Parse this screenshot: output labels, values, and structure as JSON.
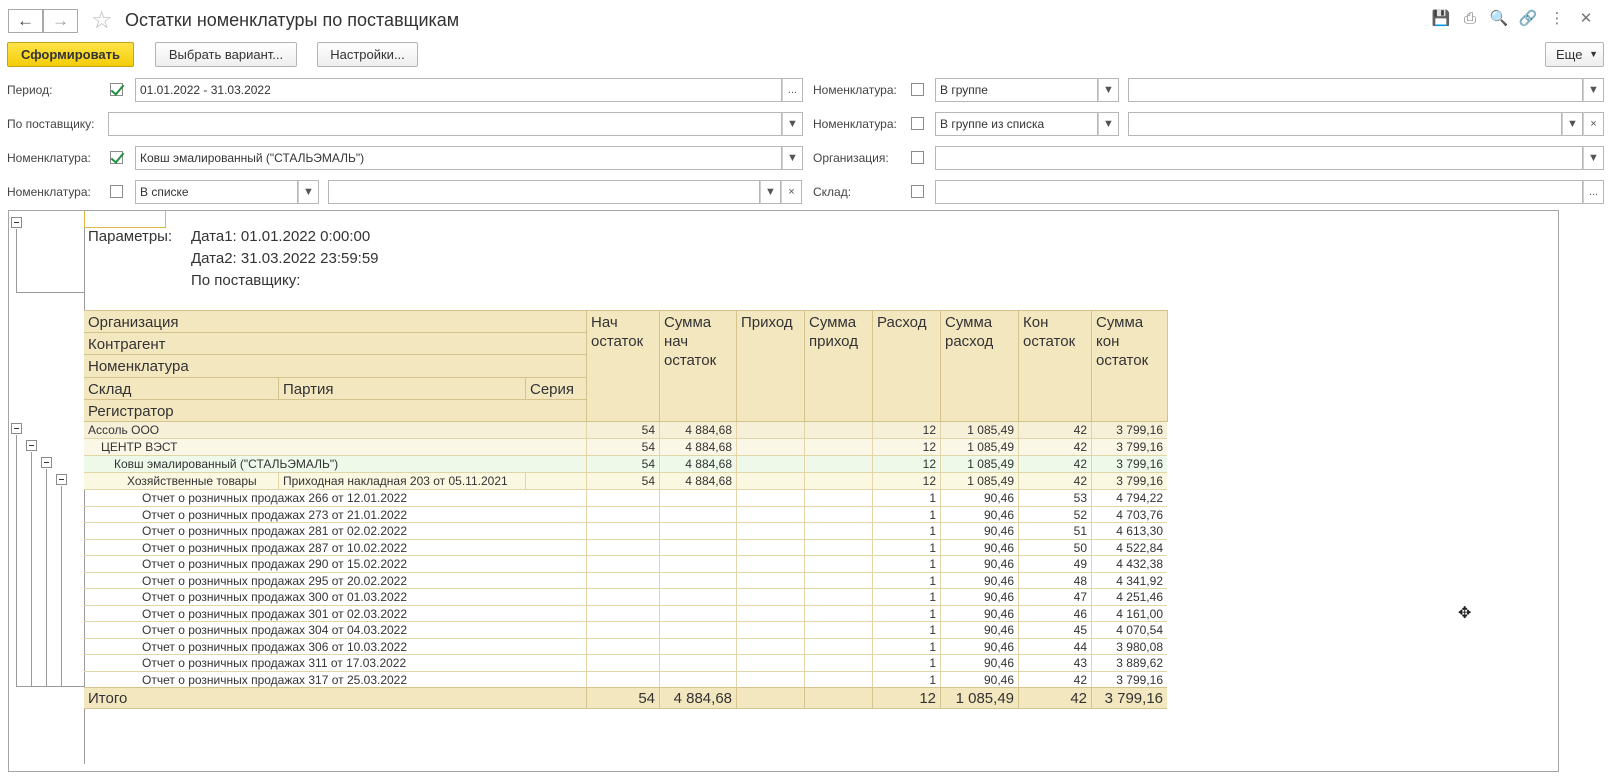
{
  "window": {
    "title": "Остатки номенклатуры по поставщикам"
  },
  "toolbar": {
    "generate_label": "Сформировать",
    "choose_variant_label": "Выбрать вариант...",
    "settings_label": "Настройки...",
    "more_label": "Еще"
  },
  "filters": {
    "period_label": "Период:",
    "period_value": "01.01.2022 - 31.03.2022",
    "supplier_label": "По поставщику:",
    "supplier_value": "",
    "nom1_label": "Номенклатура:",
    "nom1_value": "Ковш эмалированный (\"СТАЛЬЭМАЛЬ\")",
    "nom2_label": "Номенклатура:",
    "nom2_mode": "В списке",
    "nom2_value": "",
    "nom_right1_label": "Номенклатура:",
    "nom_right1_mode": "В группе",
    "nom_right1_value": "",
    "nom_right2_label": "Номенклатура:",
    "nom_right2_mode": "В группе из списка",
    "nom_right2_value": "",
    "org_label": "Организация:",
    "org_value": "",
    "warehouse_label": "Склад:",
    "warehouse_value": "",
    "dots": "...",
    "clear": "×"
  },
  "report": {
    "params_label": "Параметры:",
    "date1": "Дата1: 01.01.2022 0:00:00",
    "date2": "Дата2: 31.03.2022 23:59:59",
    "supplier": "По поставщику:",
    "headers": {
      "org": "Организация",
      "contractor": "Контрагент",
      "nomenclature": "Номенклатура",
      "warehouse": "Склад",
      "batch": "Партия",
      "series": "Серия",
      "registrar": "Регистратор",
      "start_qty": "Нач остаток",
      "start_sum": "Сумма нач остаток",
      "income": "Приход",
      "income_sum": "Сумма приход",
      "expense": "Расход",
      "expense_sum": "Сумма расход",
      "end_qty": "Кон остаток",
      "end_sum": "Сумма кон остаток"
    },
    "groups": [
      {
        "label": "Ассоль ООО",
        "start_qty": "54",
        "start_sum": "4 884,68",
        "expense": "12",
        "expense_sum": "1 085,49",
        "end_qty": "42",
        "end_sum": "3 799,16"
      },
      {
        "label": "ЦЕНТР ВЭСТ",
        "start_qty": "54",
        "start_sum": "4 884,68",
        "expense": "12",
        "expense_sum": "1 085,49",
        "end_qty": "42",
        "end_sum": "3 799,16"
      },
      {
        "label": "Ковш эмалированный (\"СТАЛЬЭМАЛЬ\")",
        "start_qty": "54",
        "start_sum": "4 884,68",
        "expense": "12",
        "expense_sum": "1 085,49",
        "end_qty": "42",
        "end_sum": "3 799,16"
      },
      {
        "label": "Хозяйственные товары",
        "batch": "Приходная накладная 203 от 05.11.2021",
        "start_qty": "54",
        "start_sum": "4 884,68",
        "expense": "12",
        "expense_sum": "1 085,49",
        "end_qty": "42",
        "end_sum": "3 799,16"
      }
    ],
    "rows": [
      {
        "label": "Отчет о розничных продажах 266 от 12.01.2022",
        "expense": "1",
        "expense_sum": "90,46",
        "end_qty": "53",
        "end_sum": "4 794,22"
      },
      {
        "label": "Отчет о розничных продажах 273 от 21.01.2022",
        "expense": "1",
        "expense_sum": "90,46",
        "end_qty": "52",
        "end_sum": "4 703,76"
      },
      {
        "label": "Отчет о розничных продажах 281 от 02.02.2022",
        "expense": "1",
        "expense_sum": "90,46",
        "end_qty": "51",
        "end_sum": "4 613,30"
      },
      {
        "label": "Отчет о розничных продажах 287 от 10.02.2022",
        "expense": "1",
        "expense_sum": "90,46",
        "end_qty": "50",
        "end_sum": "4 522,84"
      },
      {
        "label": "Отчет о розничных продажах 290 от 15.02.2022",
        "expense": "1",
        "expense_sum": "90,46",
        "end_qty": "49",
        "end_sum": "4 432,38"
      },
      {
        "label": "Отчет о розничных продажах 295 от 20.02.2022",
        "expense": "1",
        "expense_sum": "90,46",
        "end_qty": "48",
        "end_sum": "4 341,92"
      },
      {
        "label": "Отчет о розничных продажах 300 от 01.03.2022",
        "expense": "1",
        "expense_sum": "90,46",
        "end_qty": "47",
        "end_sum": "4 251,46"
      },
      {
        "label": "Отчет о розничных продажах 301 от 02.03.2022",
        "expense": "1",
        "expense_sum": "90,46",
        "end_qty": "46",
        "end_sum": "4 161,00"
      },
      {
        "label": "Отчет о розничных продажах 304 от 04.03.2022",
        "expense": "1",
        "expense_sum": "90,46",
        "end_qty": "45",
        "end_sum": "4 070,54"
      },
      {
        "label": "Отчет о розничных продажах 306 от 10.03.2022",
        "expense": "1",
        "expense_sum": "90,46",
        "end_qty": "44",
        "end_sum": "3 980,08"
      },
      {
        "label": "Отчет о розничных продажах 311 от 17.03.2022",
        "expense": "1",
        "expense_sum": "90,46",
        "end_qty": "43",
        "end_sum": "3 889,62"
      },
      {
        "label": "Отчет о розничных продажах 317 от 25.03.2022",
        "expense": "1",
        "expense_sum": "90,46",
        "end_qty": "42",
        "end_sum": "3 799,16"
      }
    ],
    "total": {
      "label": "Итого",
      "start_qty": "54",
      "start_sum": "4 884,68",
      "expense": "12",
      "expense_sum": "1 085,49",
      "end_qty": "42",
      "end_sum": "3 799,16"
    }
  },
  "colors": {
    "header_bg": "#f3e7c0",
    "group1_bg": "#f7f0d8",
    "group2_bg": "#fbf7e6",
    "group3_bg": "#eef9ea",
    "group4_bg": "#fbf8e1",
    "primary_button": "#f4cd08"
  }
}
